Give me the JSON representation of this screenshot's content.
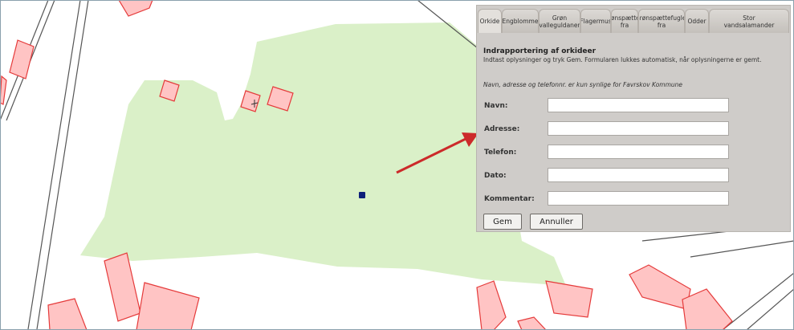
{
  "tabs": [
    {
      "label": "Orkide"
    },
    {
      "label": "Engblomme"
    },
    {
      "label": "Grøn\nvalleguldaner"
    },
    {
      "label": "Flagermus"
    },
    {
      "label": "Grønspættefå\nfra"
    },
    {
      "label": "Grønspættefuglef\nfra"
    },
    {
      "label": "Odder"
    },
    {
      "label": "Stor\nvandsalamander"
    }
  ],
  "form": {
    "title": "Indrapportering af orkideer",
    "description": "Indtast oplysninger og tryk Gem. Formularen lukkes automatisk, når oplysningerne er gemt.",
    "note": "Navn, adresse og telefonnr. er kun synlige for Favrskov Kommune",
    "fields": [
      {
        "label": "Navn:",
        "value": ""
      },
      {
        "label": "Adresse:",
        "value": ""
      },
      {
        "label": "Telefon:",
        "value": ""
      },
      {
        "label": "Dato:",
        "value": ""
      },
      {
        "label": "Kommentar:",
        "value": ""
      }
    ],
    "save_label": "Gem",
    "cancel_label": "Annuller"
  },
  "colors": {
    "park": "#daf0c8",
    "building_fill": "#ffc4c4",
    "building_stroke": "#e53a3a",
    "arrow": "#cc2a2a",
    "marker": "#0d1f7a",
    "panel_bg": "#cfccc9"
  }
}
